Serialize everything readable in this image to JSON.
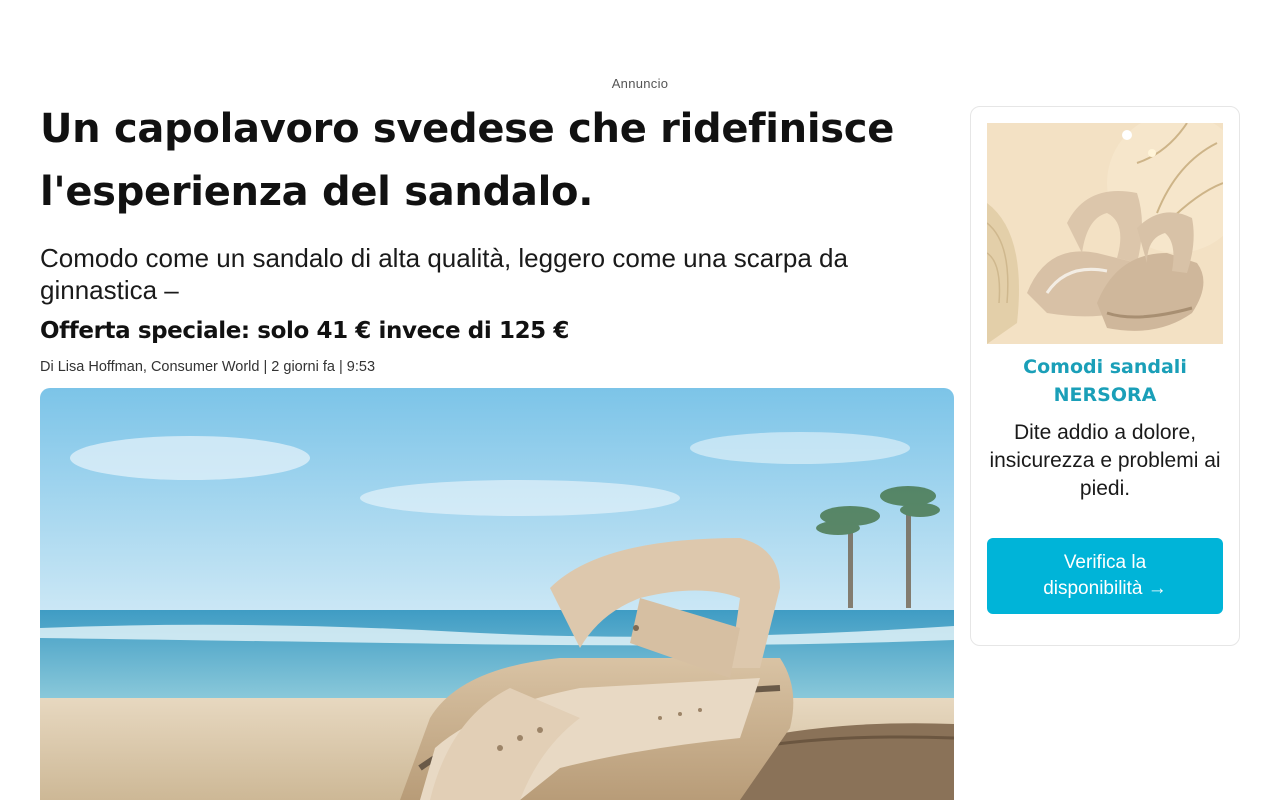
{
  "ad_label": "Annuncio",
  "article": {
    "headline": "Un capolavoro svedese che ridefinisce l'esperienza del sandalo.",
    "subhead": "Comodo come un sandalo di alta qualità, leggero come una scarpa da ginnastica –",
    "offer": "Offerta speciale: solo 41 € invece di 125 €",
    "byline": "Di Lisa Hoffman, Consumer World | 2 giorni fa | 9:53",
    "hero_image": "beach-sandal-photo"
  },
  "sidebar": {
    "image": "sandals-product-photo",
    "title": "Comodi sandali NERSORA",
    "text": "Dite addio a dolore, insicurezza e problemi ai piedi.",
    "cta_label": "Verifica la disponibilità →"
  },
  "colors": {
    "accent": "#00b4d8",
    "title_teal": "#1a9fb8"
  }
}
